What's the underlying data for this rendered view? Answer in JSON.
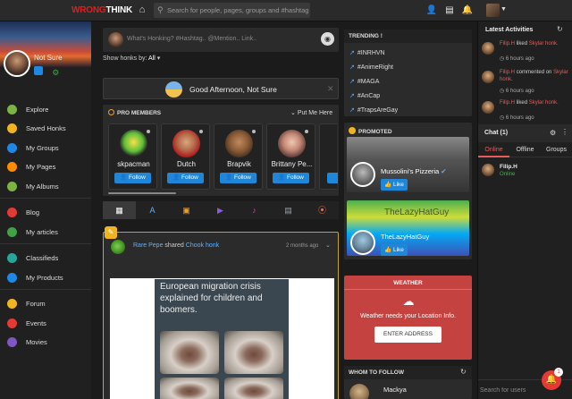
{
  "topbar": {
    "logo_a": "WRONG",
    "logo_b": "THINK",
    "search_placeholder": "Search for people, pages, groups and #hashtags"
  },
  "profile": {
    "name": "Not Sure"
  },
  "nav": [
    {
      "label": "Explore",
      "color": "#7cb342"
    },
    {
      "label": "Saved Honks",
      "color": "#f2b41e"
    },
    {
      "label": "My Groups",
      "color": "#1e88e5"
    },
    {
      "label": "My Pages",
      "color": "#fb8c00"
    },
    {
      "label": "My Albums",
      "color": "#7cb342"
    },
    {
      "label": "Blog",
      "color": "#e53935"
    },
    {
      "label": "My articles",
      "color": "#43a047"
    },
    {
      "label": "Classifieds",
      "color": "#26a69a"
    },
    {
      "label": "My Products",
      "color": "#1e88e5"
    },
    {
      "label": "Forum",
      "color": "#f2b41e"
    },
    {
      "label": "Events",
      "color": "#e53935"
    },
    {
      "label": "Movies",
      "color": "#7e57c2"
    }
  ],
  "composer": {
    "placeholder": "What's Honking? #Hashtag.. @Mention.. Link.."
  },
  "filter": {
    "label": "Show honks by:",
    "value": "All"
  },
  "greeting": "Good Afternoon, Not Sure",
  "pro_members": {
    "title": "PRO MEMBERS",
    "put_me_here": "Put Me Here",
    "follow_label": "Follow",
    "members": [
      {
        "name": "skpacman"
      },
      {
        "name": "Dutch"
      },
      {
        "name": "Brapvik"
      },
      {
        "name": "Brittany Pe..."
      }
    ]
  },
  "post": {
    "author": "Rare Pepe",
    "action": "shared",
    "target_user": "Chook",
    "target_type": "honk",
    "time": "2 months ago",
    "meme_caption": "European migration crisis explained for children and boomers."
  },
  "trending": {
    "title": "TRENDING !",
    "tags": [
      "#INRHVN",
      "#AnimeRight",
      "#MAGA",
      "#AnCap",
      "#TrapsAreGay"
    ]
  },
  "promoted": {
    "title": "PROMOTED",
    "like_label": "Like",
    "pages": [
      {
        "name": "Mussolini's Pizzeria",
        "overlay": ""
      },
      {
        "name": "TheLazyHatGuy",
        "overlay": "TheLazyHatGuy"
      }
    ]
  },
  "weather": {
    "title": "WEATHER",
    "message": "Weather needs your Location Info.",
    "button": "ENTER ADDRESS"
  },
  "who_to_follow": {
    "title": "WHOM TO FOLLOW",
    "user": "Mackya"
  },
  "activities": {
    "title": "Latest Activities",
    "items": [
      {
        "user": "Filip.H",
        "verb": "liked",
        "target": "Skylar honk.",
        "time": "6 hours ago"
      },
      {
        "user": "Filip.H",
        "verb": "commented on",
        "target": "Skylar honk.",
        "time": "6 hours ago"
      },
      {
        "user": "Filip.H",
        "verb": "liked",
        "target": "Skylar honk.",
        "time": "6 hours ago"
      }
    ]
  },
  "chat": {
    "title": "Chat (1)",
    "tabs": [
      "Online",
      "Offline",
      "Groups"
    ],
    "user": {
      "name": "Filip.H",
      "status": "Online"
    },
    "search_placeholder": "Search for users"
  },
  "notifications": {
    "count": "1"
  },
  "colors": {
    "accent_red": "#e21c1c",
    "follow_blue": "#1f86d8",
    "weather_red": "#c4423f",
    "gold": "#f2b41e"
  }
}
